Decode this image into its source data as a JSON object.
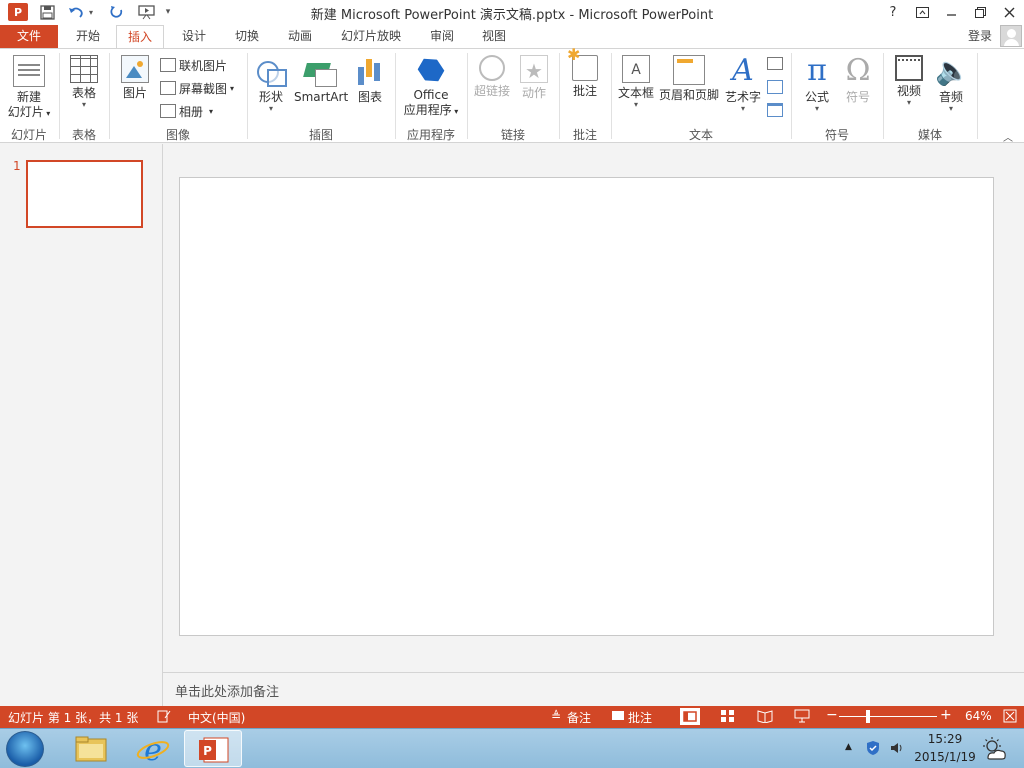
{
  "titlebar": {
    "app_icon_letter": "P",
    "title": "新建 Microsoft PowerPoint 演示文稿.pptx - Microsoft PowerPoint",
    "help": "?"
  },
  "tabs": [
    {
      "label": "文件"
    },
    {
      "label": "开始"
    },
    {
      "label": "插入"
    },
    {
      "label": "设计"
    },
    {
      "label": "切换"
    },
    {
      "label": "动画"
    },
    {
      "label": "幻灯片放映"
    },
    {
      "label": "审阅"
    },
    {
      "label": "视图"
    }
  ],
  "account": {
    "signin": "登录"
  },
  "ribbon": {
    "groups": {
      "slides": "幻灯片",
      "tables": "表格",
      "images": "图像",
      "illustrations": "插图",
      "apps": "应用程序",
      "links": "链接",
      "comments": "批注",
      "text": "文本",
      "symbols": "符号",
      "media": "媒体"
    },
    "new_slide": {
      "line1": "新建",
      "line2": "幻灯片"
    },
    "table": "表格",
    "picture": "图片",
    "online_picture": "联机图片",
    "screenshot": "屏幕截图",
    "album": "相册",
    "shapes": "形状",
    "smartart": "SmartArt",
    "chart": "图表",
    "office_apps": {
      "line1": "Office",
      "line2": "应用程序"
    },
    "hyperlink": "超链接",
    "action": "动作",
    "comment": "批注",
    "textbox": "文本框",
    "header_footer": "页眉和页脚",
    "wordart": "艺术字",
    "equation": "公式",
    "symbol": "符号",
    "video": "视频",
    "audio": "音频"
  },
  "thumbnails": {
    "slide1_number": "1"
  },
  "notes": {
    "placeholder": "单击此处添加备注"
  },
  "status": {
    "slide_info": "幻灯片 第 1 张，共 1 张",
    "language": "中文(中国)",
    "notes": "备注",
    "comments": "批注",
    "zoom": "64%"
  },
  "taskbar": {
    "time": "15:29",
    "date": "2015/1/19"
  },
  "colors": {
    "accent": "#d24726"
  }
}
